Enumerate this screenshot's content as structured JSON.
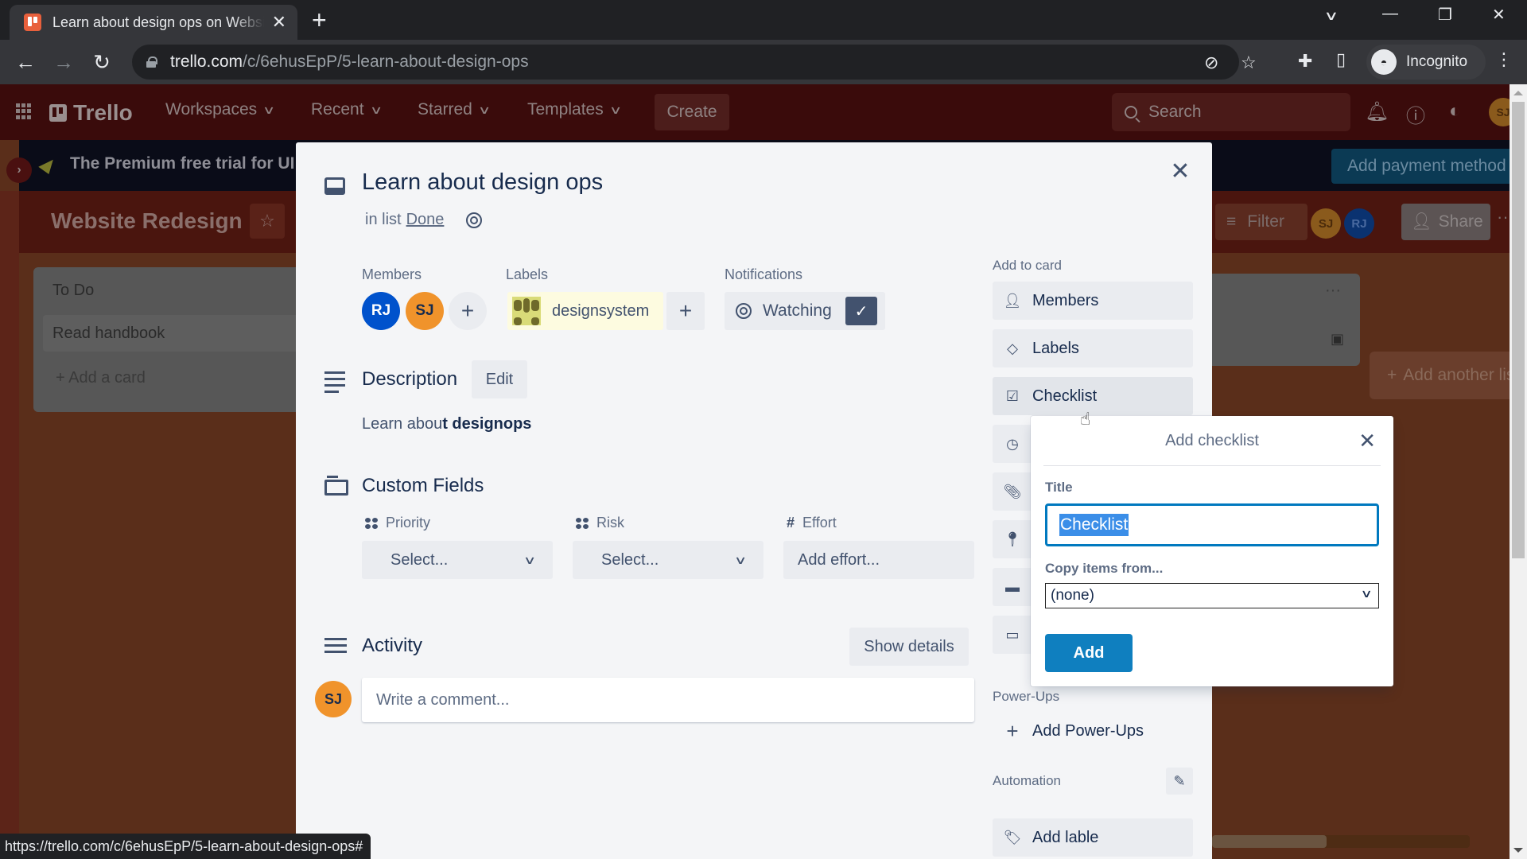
{
  "browser": {
    "tab_title": "Learn about design ops on Website Redesign",
    "url_host": "trello.com",
    "url_path": "/c/6ehusEpP/5-learn-about-design-ops",
    "profile_label": "Incognito",
    "status_url": "https://trello.com/c/6ehusEpP/5-learn-about-design-ops#"
  },
  "topnav": {
    "logo": "Trello",
    "menus": [
      "Workspaces",
      "Recent",
      "Starred",
      "Templates"
    ],
    "create_label": "Create",
    "search_placeholder": "Search",
    "user_initials": "SJ"
  },
  "banner": {
    "text": "The Premium free trial for UI Design ends soon",
    "payment_label": "Add payment method"
  },
  "board": {
    "title": "Website Redesign",
    "filter_label": "Filter",
    "members": [
      {
        "initials": "SJ",
        "color": "#8a5a1c"
      },
      {
        "initials": "RJ",
        "color": "#0a3270"
      }
    ],
    "share_label": "Share",
    "lists": [
      {
        "title": "To Do",
        "cards": [
          "Read handbook"
        ],
        "add_card_label": "Add a card"
      }
    ],
    "add_list_label": "Add another list"
  },
  "card": {
    "title": "Learn about design ops",
    "in_list_prefix": "in list",
    "list_name": "Done",
    "members_label": "Members",
    "members": [
      {
        "initials": "RJ",
        "color": "#0052cc"
      },
      {
        "initials": "SJ",
        "color": "#f0932b"
      }
    ],
    "labels_label": "Labels",
    "label_name": "designsystem",
    "notifications_label": "Notifications",
    "watch_label": "Watching",
    "description_title": "Description",
    "edit_label": "Edit",
    "description_plain": "Learn abou",
    "description_bold": "t designops",
    "custom_fields_title": "Custom Fields",
    "custom_fields": [
      {
        "name": "Priority",
        "value": "Select...",
        "type": "dropdown"
      },
      {
        "name": "Risk",
        "value": "Select...",
        "type": "dropdown"
      },
      {
        "name": "Effort",
        "value": "Add effort...",
        "type": "number"
      }
    ],
    "activity_title": "Activity",
    "show_details_label": "Show details",
    "comment_placeholder": "Write a comment...",
    "commenter_initials": "SJ"
  },
  "sidebar": {
    "add_to_card_label": "Add to card",
    "items": [
      {
        "label": "Members",
        "icon": "person-icon"
      },
      {
        "label": "Labels",
        "icon": "tag-icon"
      },
      {
        "label": "Checklist",
        "icon": "checkbox-icon"
      },
      {
        "label": "Dates",
        "icon": "clock-icon"
      },
      {
        "label": "Attachment",
        "icon": "paperclip-icon"
      },
      {
        "label": "Location",
        "icon": "pin-icon"
      },
      {
        "label": "Cover",
        "icon": "cover-icon"
      },
      {
        "label": "Custom Fields",
        "icon": "custom-fields-icon"
      }
    ],
    "powerups_label": "Power-Ups",
    "add_powerups_label": "Add Power-Ups",
    "automation_label": "Automation",
    "add_lable_label": "Add lable"
  },
  "checklist_popover": {
    "title": "Add checklist",
    "title_field_label": "Title",
    "title_value": "Checklist",
    "copy_label": "Copy items from...",
    "copy_selected": "(none)",
    "add_label": "Add"
  }
}
